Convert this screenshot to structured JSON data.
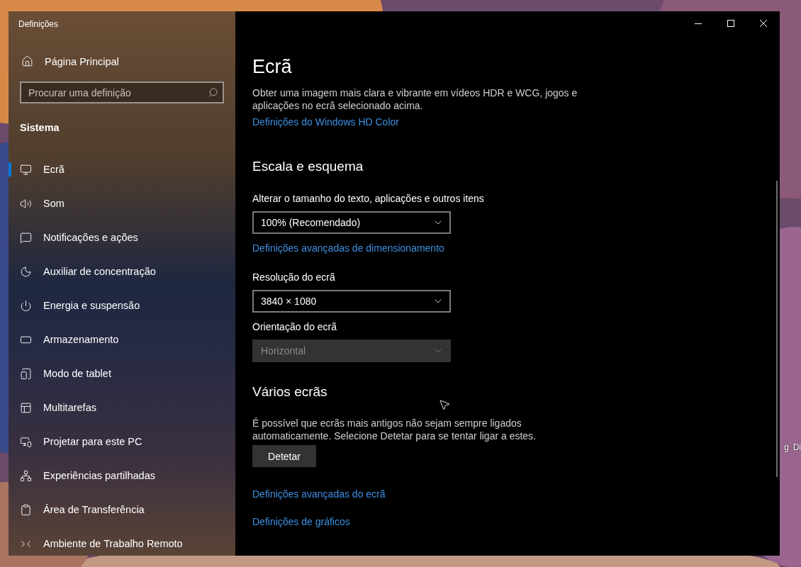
{
  "desktop": {
    "labels": [
      "g",
      "Di"
    ]
  },
  "window": {
    "title": "Definições"
  },
  "sidebar": {
    "home": "Página Principal",
    "search": {
      "placeholder": "Procurar uma definição"
    },
    "section": "Sistema",
    "items": [
      {
        "label": "Ecrã",
        "selected": true
      },
      {
        "label": "Som",
        "selected": false
      },
      {
        "label": "Notificações e ações",
        "selected": false
      },
      {
        "label": "Auxiliar de concentração",
        "selected": false
      },
      {
        "label": "Energia e suspensão",
        "selected": false
      },
      {
        "label": "Armazenamento",
        "selected": false
      },
      {
        "label": "Modo de tablet",
        "selected": false
      },
      {
        "label": "Multitarefas",
        "selected": false
      },
      {
        "label": "Projetar para este PC",
        "selected": false
      },
      {
        "label": "Experiências partilhadas",
        "selected": false
      },
      {
        "label": "Área de Transferência",
        "selected": false
      },
      {
        "label": "Ambiente de Trabalho Remoto",
        "selected": false
      }
    ]
  },
  "main": {
    "title": "Ecrã",
    "blocks": [
      {
        "kind": "text",
        "text": "Obter uma imagem mais clara e vibrante em vídeos HDR e WCG, jogos e aplicações no ecrã selecionado acima."
      },
      {
        "kind": "link",
        "text": "Definições do Windows HD Color"
      },
      {
        "kind": "heading",
        "text": "Escala e esquema"
      },
      {
        "kind": "label",
        "text": "Alterar o tamanho do texto, aplicações e outros itens"
      },
      {
        "kind": "dropdown",
        "text": "100% (Recomendado)",
        "disabled": false
      },
      {
        "kind": "link",
        "text": "Definições avançadas de dimensionamento"
      },
      {
        "kind": "label",
        "text": "Resolução do ecrã"
      },
      {
        "kind": "dropdown",
        "text": "3840 × 1080",
        "disabled": false
      },
      {
        "kind": "label",
        "text": "Orientação do ecrã"
      },
      {
        "kind": "dropdown",
        "text": "Horizontal",
        "disabled": true
      },
      {
        "kind": "heading",
        "text": "Vários ecrãs"
      },
      {
        "kind": "text",
        "text": "É possível que ecrãs mais antigos não sejam sempre ligados automaticamente. Selecione Detetar para se tentar ligar a estes."
      },
      {
        "kind": "button",
        "text": "Detetar"
      },
      {
        "kind": "spacer_link",
        "text": "Definições avançadas do ecrã"
      },
      {
        "kind": "spacer_link",
        "text": "Definições de gráficos"
      }
    ]
  }
}
